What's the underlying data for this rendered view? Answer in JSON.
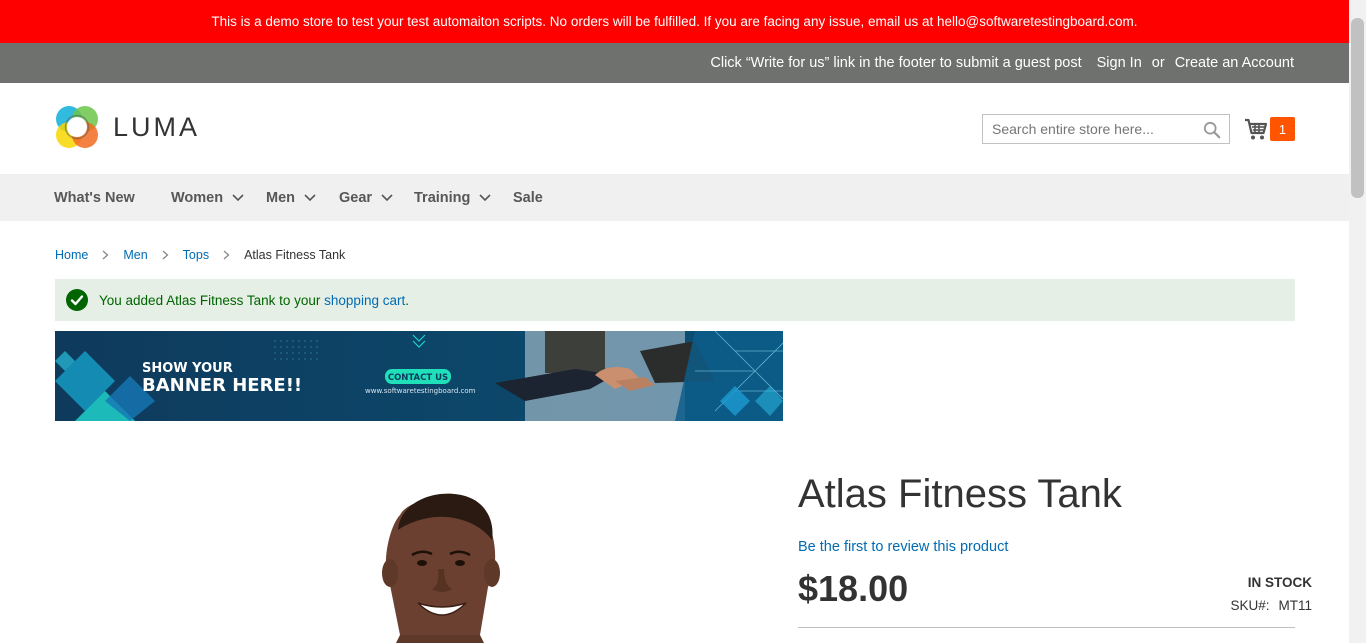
{
  "demo_notice": "This is a demo store to test your test automaiton scripts. No orders will be fulfilled. If you are facing any issue, email us at hello@softwaretestingboard.com.",
  "header": {
    "promo_text": "Click “Write for us” link in the footer to submit a guest post",
    "sign_in": "Sign In",
    "or": "or",
    "create_account": "Create an Account"
  },
  "logo": {
    "text": "LUMA"
  },
  "search": {
    "placeholder": "Search entire store here...",
    "value": ""
  },
  "minicart": {
    "count": "1"
  },
  "nav": [
    {
      "label": "What's New",
      "has_dropdown": false
    },
    {
      "label": "Women",
      "has_dropdown": true
    },
    {
      "label": "Men",
      "has_dropdown": true
    },
    {
      "label": "Gear",
      "has_dropdown": true
    },
    {
      "label": "Training",
      "has_dropdown": true
    },
    {
      "label": "Sale",
      "has_dropdown": false
    }
  ],
  "breadcrumbs": {
    "home": "Home",
    "men": "Men",
    "tops": "Tops",
    "current": "Atlas Fitness Tank"
  },
  "message": {
    "prefix": "You added Atlas Fitness Tank to your ",
    "link": "shopping cart",
    "suffix": "."
  },
  "banner": {
    "line1": "SHOW YOUR",
    "line2": "BANNER HERE!!",
    "button": "CONTACT US",
    "url": "www.softwaretestingboard.com"
  },
  "product": {
    "name": "Atlas Fitness Tank",
    "review_link": "Be the first to review this product",
    "price": "$18.00",
    "stock": "In stock",
    "sku_label": "SKU#:",
    "sku": "MT11"
  },
  "colors": {
    "demo_bar": "#ff0000",
    "header_panel": "#6e716e",
    "link": "#006bb4",
    "cart_counter": "#ff5501",
    "success_bg": "#e5efe5",
    "success_text": "#006400"
  }
}
